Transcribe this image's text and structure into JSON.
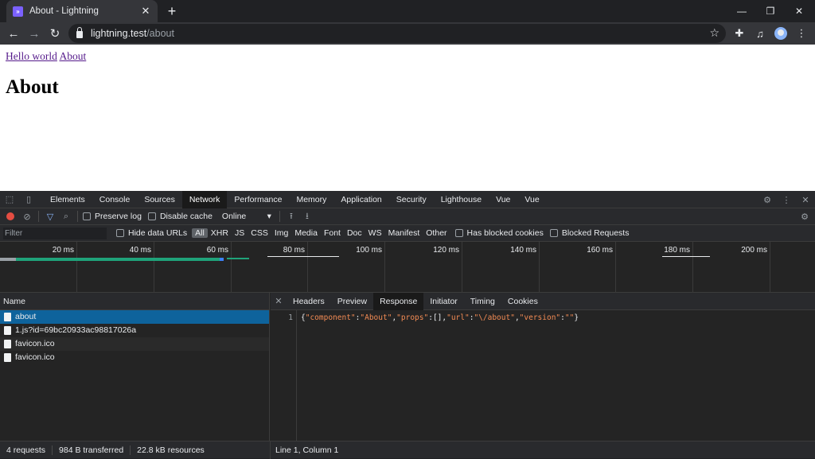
{
  "browser": {
    "tab_title": "About - Lightning",
    "url_host": "lightning.test",
    "url_path": "/about"
  },
  "page": {
    "links": [
      "Hello world",
      "About"
    ],
    "heading": "About"
  },
  "devtools": {
    "panels": [
      "Elements",
      "Console",
      "Sources",
      "Network",
      "Performance",
      "Memory",
      "Application",
      "Security",
      "Lighthouse",
      "Vue",
      "Vue"
    ],
    "active_panel": "Network",
    "toolbar": {
      "preserve_log": "Preserve log",
      "disable_cache": "Disable cache",
      "throttle": "Online"
    },
    "filter": {
      "placeholder": "Filter",
      "hide_data_urls": "Hide data URLs",
      "types": [
        "All",
        "XHR",
        "JS",
        "CSS",
        "Img",
        "Media",
        "Font",
        "Doc",
        "WS",
        "Manifest",
        "Other"
      ],
      "has_blocked_cookies": "Has blocked cookies",
      "blocked_requests": "Blocked Requests"
    },
    "overview_ticks": [
      "20 ms",
      "40 ms",
      "60 ms",
      "80 ms",
      "100 ms",
      "120 ms",
      "140 ms",
      "160 ms",
      "180 ms",
      "200 ms"
    ],
    "requests_header": "Name",
    "requests": [
      "about",
      "1.js?id=69bc20933ac98817026a",
      "favicon.ico",
      "favicon.ico"
    ],
    "detail_tabs": [
      "Headers",
      "Preview",
      "Response",
      "Initiator",
      "Timing",
      "Cookies"
    ],
    "active_detail_tab": "Response",
    "response": {
      "line_number": "1",
      "tokens": [
        {
          "t": "{",
          "c": "p"
        },
        {
          "t": "\"component\"",
          "c": "k"
        },
        {
          "t": ":",
          "c": "p"
        },
        {
          "t": "\"About\"",
          "c": "k"
        },
        {
          "t": ",",
          "c": "p"
        },
        {
          "t": "\"props\"",
          "c": "k"
        },
        {
          "t": ":[],",
          "c": "p"
        },
        {
          "t": "\"url\"",
          "c": "k"
        },
        {
          "t": ":",
          "c": "p"
        },
        {
          "t": "\"\\/about\"",
          "c": "k"
        },
        {
          "t": ",",
          "c": "p"
        },
        {
          "t": "\"version\"",
          "c": "k"
        },
        {
          "t": ":",
          "c": "p"
        },
        {
          "t": "\"\"",
          "c": "k"
        },
        {
          "t": "}",
          "c": "p"
        }
      ]
    },
    "status": {
      "requests": "4 requests",
      "transferred": "984 B transferred",
      "resources": "22.8 kB resources",
      "cursor": "Line 1, Column 1"
    }
  }
}
